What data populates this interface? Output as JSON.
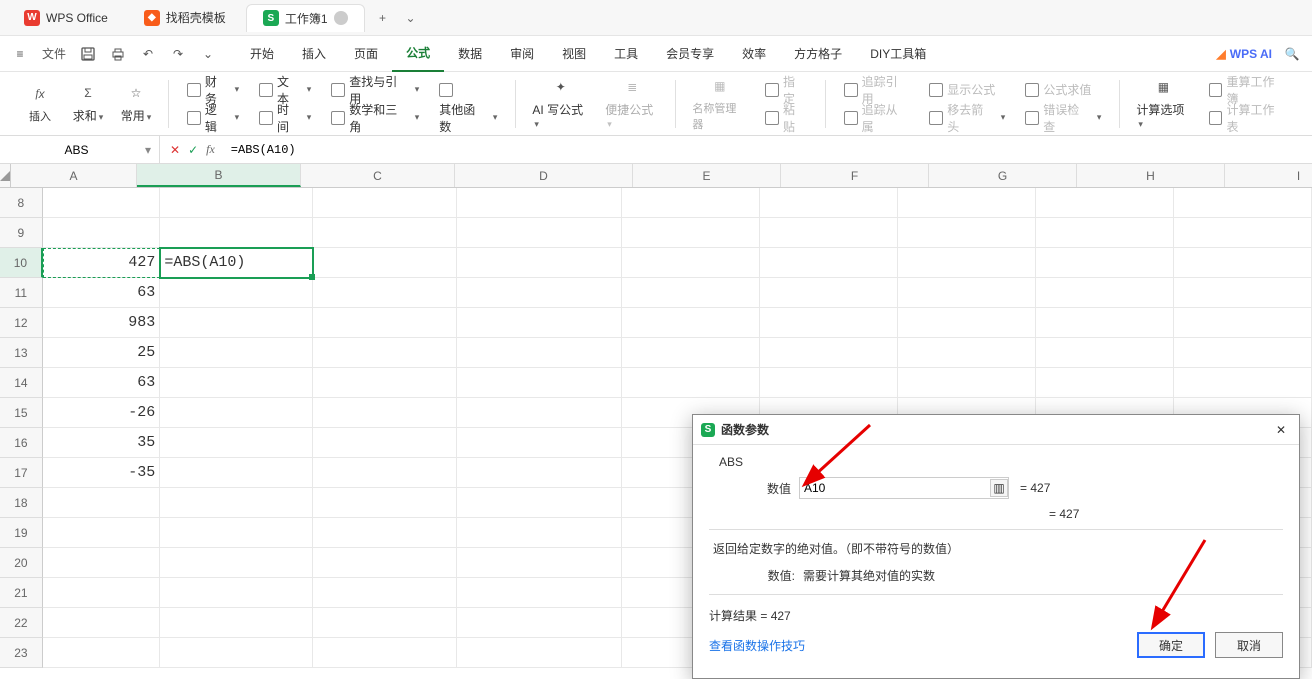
{
  "tabs": {
    "wps_office": "WPS Office",
    "template": "找稻壳模板",
    "workbook": "工作簿1",
    "plus": "+",
    "chev": "⌄"
  },
  "menubar": {
    "hamburger": "≡",
    "file": "文件",
    "icons": [
      "save-icon",
      "print-icon",
      "undo-icon",
      "redo-icon",
      "chev-icon"
    ],
    "tabs": [
      "开始",
      "插入",
      "页面",
      "公式",
      "数据",
      "审阅",
      "视图",
      "工具",
      "会员专享",
      "效率",
      "方方格子",
      "DIY工具箱"
    ],
    "wps_ai": "WPS AI",
    "search_icon": "🔍"
  },
  "ribbon": {
    "g1": {
      "insert": "插入",
      "sum": "求和",
      "common": "常用"
    },
    "g2": {
      "r1": [
        "财务",
        "文本",
        "查找与引用",
        ""
      ],
      "r2": [
        "逻辑",
        "时间",
        "数学和三角",
        "其他函数"
      ]
    },
    "g3": {
      "ai": "AI 写公式",
      "qf": "便捷公式"
    },
    "g4": {
      "name_mgr": "名称管理器",
      "r1": "指定",
      "r2": "粘贴"
    },
    "g5": {
      "a": "追踪引用",
      "b": "追踪从属",
      "c": "显示公式",
      "d": "移去箭头",
      "e": "公式求值",
      "f": "错误检查"
    },
    "g6": {
      "calc": "计算选项",
      "rw": "重算工作簿",
      "rs": "计算工作表"
    }
  },
  "formula_bar": {
    "namebox": "ABS",
    "cancel": "✕",
    "confirm": "✓",
    "fx": "fx",
    "formula": "=ABS(A10)"
  },
  "grid": {
    "cols": [
      "A",
      "B",
      "C",
      "D",
      "E",
      "F",
      "G",
      "H",
      "I"
    ],
    "first_row": 8,
    "active_col": "B",
    "active_row": 10,
    "a_values": {
      "10": "427",
      "11": "63",
      "12": "983",
      "13": "25",
      "14": "63",
      "15": "-26",
      "16": "35",
      "17": "-35"
    },
    "b10_display": "=ABS(A10)"
  },
  "dialog": {
    "title": "函数参数",
    "fn": "ABS",
    "arg_label": "数值",
    "arg_input": "A10",
    "arg_eq": "= 427",
    "result_eq": "= 427",
    "desc_line1": "返回给定数字的绝对值。（即不带符号的数值）",
    "desc_label": "数值:",
    "desc_text": "需要计算其绝对值的实数",
    "calc_result_label": "计算结果 =",
    "calc_result_value": "427",
    "help_link": "查看函数操作技巧",
    "ok": "确定",
    "cancel": "取消"
  },
  "chart_data": null
}
